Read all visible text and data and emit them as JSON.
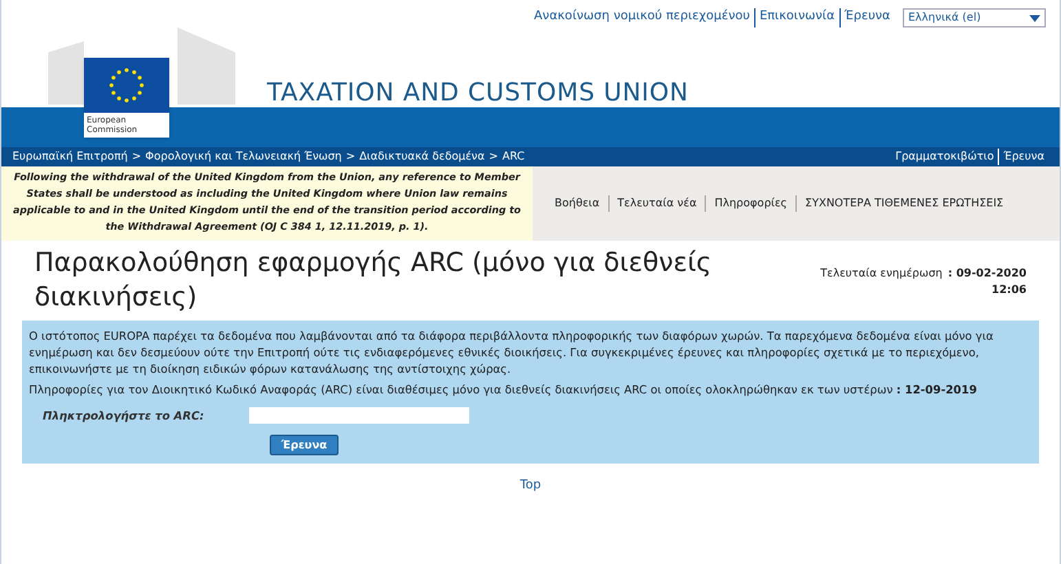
{
  "top_links": [
    "Ανακοίνωση νομικού περιεχομένου",
    "Επικοινωνία",
    "Έρευνα"
  ],
  "language_select": {
    "value": "Ελληνικά (el)"
  },
  "logo": {
    "caption": "European Commission"
  },
  "site_title": "TAXATION AND CUSTOMS UNION",
  "breadcrumb": {
    "separator": ">",
    "items": [
      "Ευρωπαϊκή Επιτροπή",
      "Φορολογική και Τελωνειακή Ένωση",
      "Διαδικτυακά δεδομένα",
      "ARC"
    ]
  },
  "utility_links": [
    "Γραμματοκιβώτιο",
    "Έρευνα"
  ],
  "notice": "Following the withdrawal of the United Kingdom from the Union, any reference to Member States shall be understood as including the United Kingdom where Union law remains applicable to and in the United Kingdom until the end of the transition period according to the Withdrawal Agreement (OJ C 384 1, 12.11.2019, p. 1).",
  "nav_links": [
    "Βοήθεια",
    "Τελευταία νέα",
    "Πληροφορίες",
    "ΣΥΧΝΟΤΕΡΑ ΤΙΘΕΜΕΝΕΣ ΕΡΩΤΗΣΕΙΣ"
  ],
  "page_title": "Παρακολούθηση εφαρμογής ARC (μόνο για διεθνείς διακινήσεις)",
  "last_update": {
    "label": "Τελευταία ενημέρωση",
    "date": ": 09-02-2020",
    "time": "12:06"
  },
  "info_paragraphs": [
    "Ο ιστότοπος EUROPA παρέχει τα δεδομένα που λαμβάνονται από τα διάφορα περιβάλλοντα πληροφορικής των διαφόρων χωρών. Τα παρεχόμενα δεδομένα είναι μόνο για ενημέρωση και δεν δεσμεύουν ούτε την Επιτροπή ούτε τις ενδιαφερόμενες εθνικές διοικήσεις. Για συγκεκριμένες έρευνες και πληροφορίες σχετικά με το περιεχόμενο, επικοινωνήστε με τη διοίκηση ειδικών φόρων κατανάλωσης της αντίστοιχης χώρας.",
    "Πληροφορίες για τον Διοικητικό Κωδικό Αναφοράς (ARC) είναι διαθέσιμες μόνο για διεθνείς διακινήσεις ARC οι οποίες ολοκληρώθηκαν εκ των υστέρων **: 12-09-2019**"
  ],
  "arc_form": {
    "label": "Πληκτρολογήστε το ARC:",
    "button": "Έρευνα"
  },
  "top_link": "Top"
}
